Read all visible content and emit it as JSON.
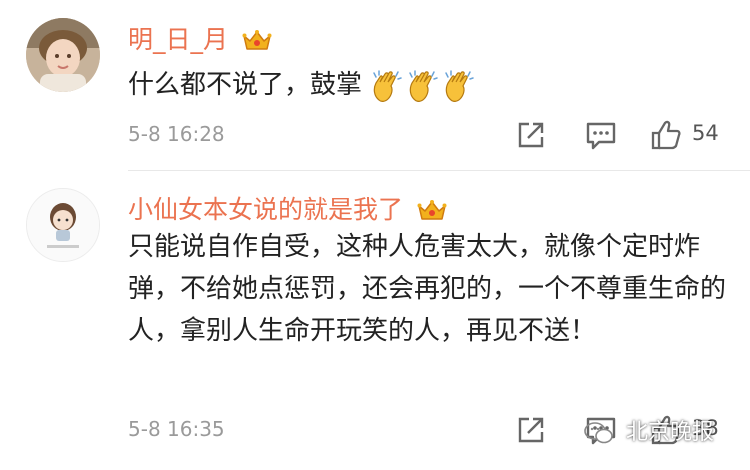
{
  "comments": [
    {
      "username": "明_日_月",
      "text": "什么都不说了，鼓掌",
      "emoji": "clapping-hands",
      "time": "5-8 16:28",
      "likes": "54"
    },
    {
      "username": "小仙女本女说的就是我了",
      "text": "只能说自作自受，这种人危害太大，就像个定时炸弹，不给她点惩罚，还会再犯的，一个不尊重生命的人，拿别人生命开玩笑的人，再见不送！",
      "time": "5-8 16:35",
      "likes": "38"
    }
  ],
  "watermark": {
    "text": "北京晚报"
  },
  "colors": {
    "username": "#eb7350",
    "text": "#222222",
    "meta": "#9a9a9a"
  },
  "icons": [
    "crown-vip-icon",
    "share-icon",
    "reply-icon",
    "thumbs-up-icon",
    "wechat-icon"
  ]
}
